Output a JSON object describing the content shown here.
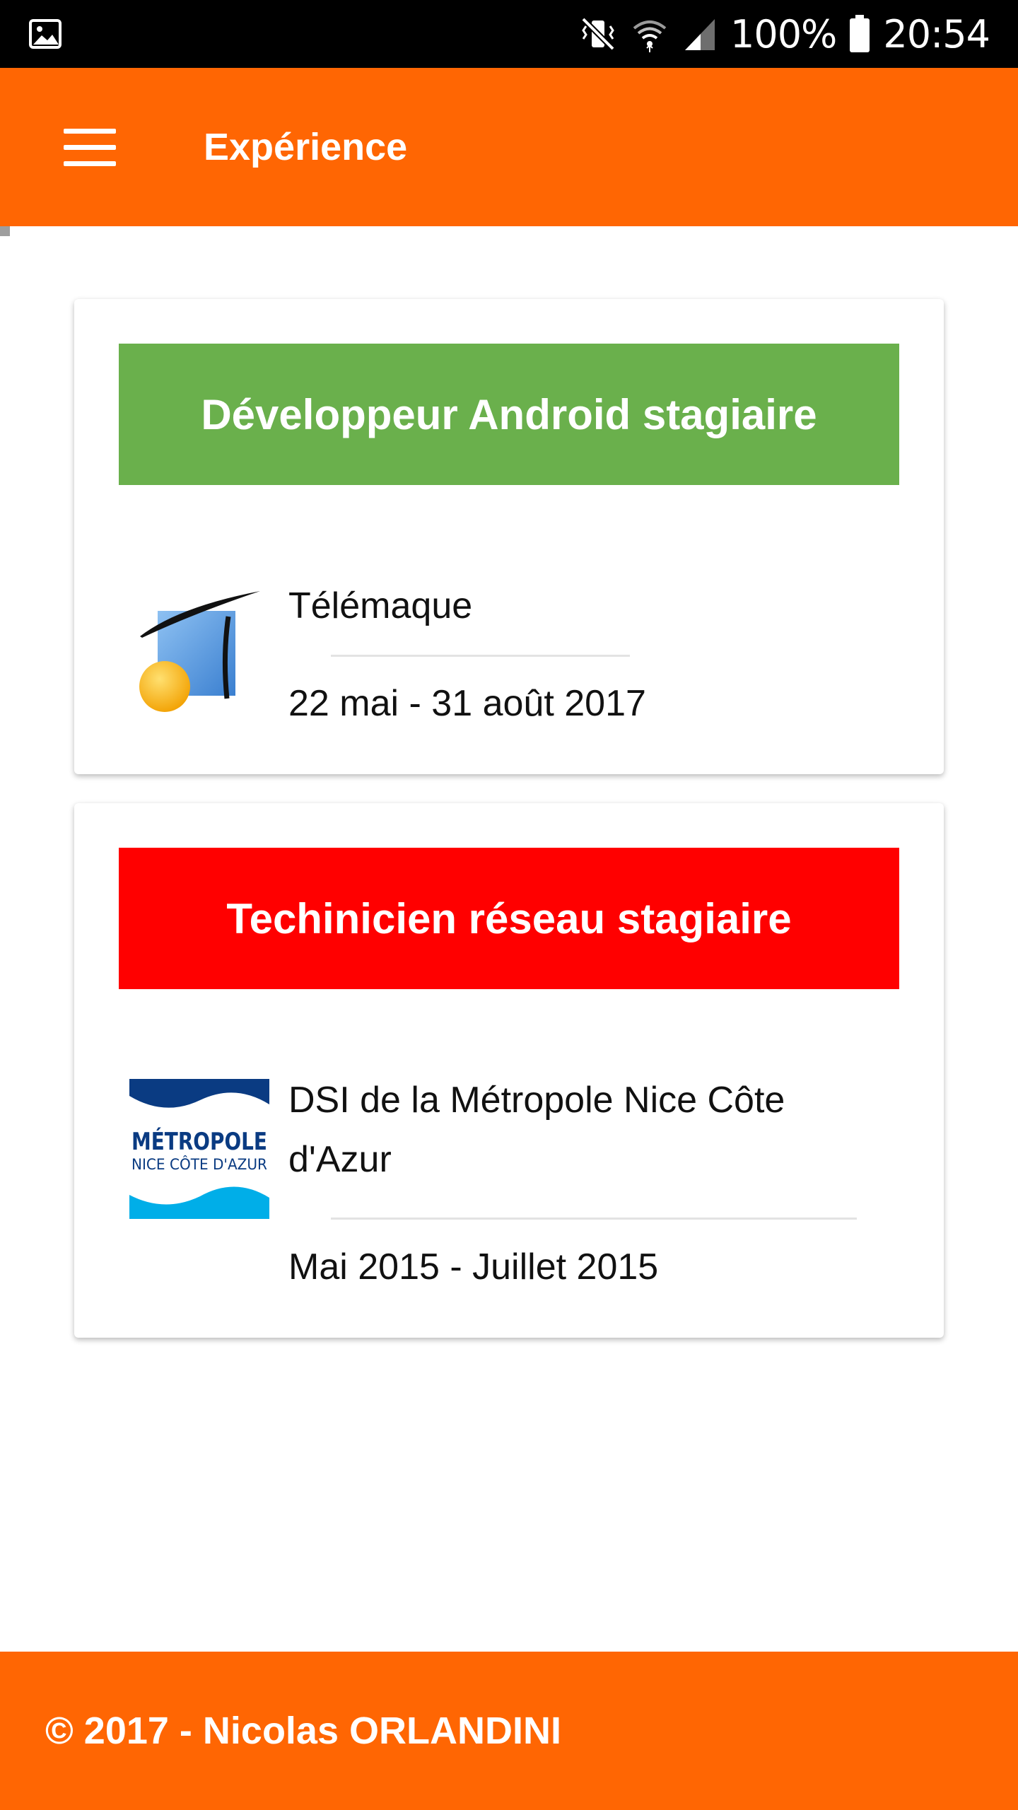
{
  "status_bar": {
    "battery": "100%",
    "time": "20:54"
  },
  "app_bar": {
    "title": "Expérience",
    "menu_icon": "menu-icon"
  },
  "experiences": [
    {
      "title": "Développeur Android stagiaire",
      "header_color": "#6ab04c",
      "company": "Télémaque",
      "dates": "22 mai - 31 août 2017",
      "logo": "telemaque-logo"
    },
    {
      "title": "Techinicien réseau stagiaire",
      "header_color": "#ff0000",
      "company": "DSI de la Métropole Nice Côte d'Azur",
      "dates": "Mai 2015 - Juillet 2015",
      "logo": "metropole-logo",
      "logo_text": [
        "MÉTROPOLE",
        "NICE CÔTE D'AZUR"
      ]
    }
  ],
  "footer": {
    "text": "© 2017 - Nicolas ORLANDINI"
  },
  "colors": {
    "accent": "#ff6603",
    "status_bar": "#000000"
  }
}
